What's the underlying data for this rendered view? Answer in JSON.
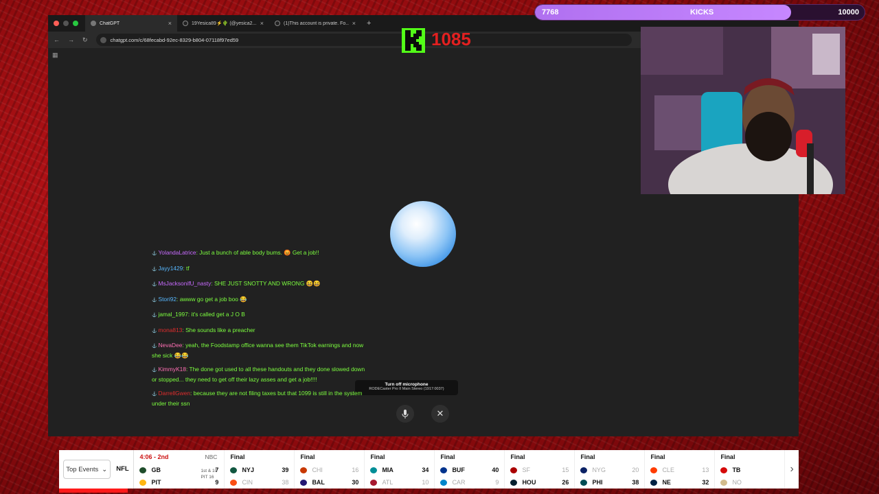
{
  "browser": {
    "tabs": [
      {
        "title": "ChatGPT",
        "active": true
      },
      {
        "title": "19Yesica89⚡🌵 (@yesica2...",
        "active": false
      },
      {
        "title": "(1)This account is private. Fo...",
        "active": false
      }
    ],
    "url": "chatgpt.com/c/68fecabd-92ec-8329-b804-07118f97ed59"
  },
  "voice": {
    "tooltip_title": "Turn off microphone",
    "tooltip_sub": "RODECaster Pro II Main Stereo (1917:0037)"
  },
  "kick": {
    "count": "1085"
  },
  "goal": {
    "current": "7768",
    "label": "KICKS",
    "target": "10000",
    "progress": 0.7768
  },
  "chat": [
    {
      "user": "YolandaLatrice",
      "user_color": "#c86bff",
      "text": "Just a bunch of able body bums. 😡 Get a job!!"
    },
    {
      "user": "Jayy1429",
      "user_color": "#58b8ff",
      "text": "tf"
    },
    {
      "user": "MsJacksonifU_nasty",
      "user_color": "#c86bff",
      "text": "SHE JUST SNOTTY AND WRONG 😆😆"
    },
    {
      "user": "Stori92",
      "user_color": "#58b8ff",
      "text": "awww go get a job boo 😂"
    },
    {
      "user": "jamal_1997",
      "user_color": "#7dff3f",
      "text": "it's called get a J O B"
    },
    {
      "user": "mona813",
      "user_color": "#e02d2d",
      "text": "She sounds like a preacher"
    },
    {
      "user": "NevaDee",
      "user_color": "#ff6fb4",
      "text": "yeah, the Foodstamp office wanna see them TikTok earnings and now she sick 😂😂"
    },
    {
      "user": "KimmyK18",
      "user_color": "#ff6fb4",
      "text": "The done got used to all these handouts and they done slowed down or stopped... they need to get off their lazy asses and get a job!!!!"
    },
    {
      "user": "DarrellGwen",
      "user_color": "#e02d2d",
      "text": "because they are not filing taxes but that 1099 is still in the system under their ssn"
    }
  ],
  "ticker": {
    "events_label": "Top Events",
    "league": "NFL",
    "games": [
      {
        "status": "4:06 - 2nd",
        "live": true,
        "network": "NBC",
        "situation": [
          "1st & 10",
          "PIT 16"
        ],
        "teams": [
          {
            "abbr": "GB",
            "score": "7",
            "color": "#1f4d2b",
            "lose": false
          },
          {
            "abbr": "PIT",
            "score": "9",
            "color": "#ffb612",
            "lose": false
          }
        ]
      },
      {
        "status": "Final",
        "teams": [
          {
            "abbr": "NYJ",
            "score": "39",
            "color": "#125740",
            "lose": false
          },
          {
            "abbr": "CIN",
            "score": "38",
            "color": "#fb4f14",
            "lose": true
          }
        ]
      },
      {
        "status": "Final",
        "teams": [
          {
            "abbr": "CHI",
            "score": "16",
            "color": "#c83803",
            "lose": true
          },
          {
            "abbr": "BAL",
            "score": "30",
            "color": "#241773",
            "lose": false
          }
        ]
      },
      {
        "status": "Final",
        "teams": [
          {
            "abbr": "MIA",
            "score": "34",
            "color": "#008e97",
            "lose": false
          },
          {
            "abbr": "ATL",
            "score": "10",
            "color": "#a71930",
            "lose": true
          }
        ]
      },
      {
        "status": "Final",
        "teams": [
          {
            "abbr": "BUF",
            "score": "40",
            "color": "#00338d",
            "lose": false
          },
          {
            "abbr": "CAR",
            "score": "9",
            "color": "#0085ca",
            "lose": true
          }
        ]
      },
      {
        "status": "Final",
        "teams": [
          {
            "abbr": "SF",
            "score": "15",
            "color": "#aa0000",
            "lose": true
          },
          {
            "abbr": "HOU",
            "score": "26",
            "color": "#03202f",
            "lose": false
          }
        ]
      },
      {
        "status": "Final",
        "teams": [
          {
            "abbr": "NYG",
            "score": "20",
            "color": "#0b2265",
            "lose": true
          },
          {
            "abbr": "PHI",
            "score": "38",
            "color": "#004c54",
            "lose": false
          }
        ]
      },
      {
        "status": "Final",
        "teams": [
          {
            "abbr": "CLE",
            "score": "13",
            "color": "#ff3c00",
            "lose": true
          },
          {
            "abbr": "NE",
            "score": "32",
            "color": "#002244",
            "lose": false
          }
        ]
      },
      {
        "status": "Final",
        "teams": [
          {
            "abbr": "TB",
            "score": "",
            "color": "#d50a0a",
            "lose": false
          },
          {
            "abbr": "NO",
            "score": "",
            "color": "#d3bc8d",
            "lose": true
          }
        ]
      }
    ]
  }
}
